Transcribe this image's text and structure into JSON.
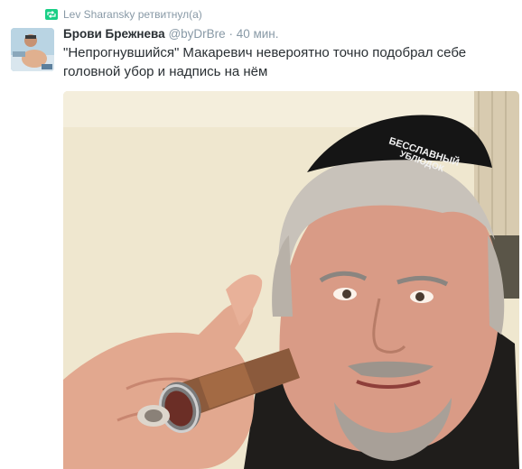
{
  "retweet": {
    "icon": "retweet-icon",
    "user": "Lev Sharansky",
    "action": "ретвитнул(а)"
  },
  "tweet": {
    "fullname": "Брови Брежнева",
    "username": "@byDrBre",
    "separator": "·",
    "time": "40 мин.",
    "text": "\"Непрогнувшийся\" Макаревич невероятно точно подобрал себе головной убор и надпись на нём"
  },
  "photo": {
    "cap_text_line1": "БЕССЛАВНЫЙ",
    "cap_text_line2": "УБЛЮДОК"
  },
  "colors": {
    "retweet_green": "#19cf86",
    "meta_grey": "#8899a6",
    "text": "#292f33"
  }
}
